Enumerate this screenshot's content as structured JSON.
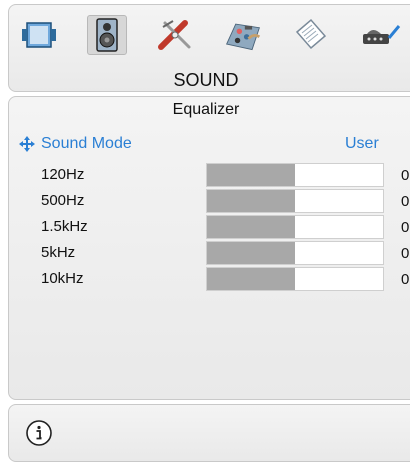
{
  "menu": {
    "icons": [
      {
        "name": "picture-icon",
        "selected": false
      },
      {
        "name": "speaker-icon",
        "selected": true
      },
      {
        "name": "tools-icon",
        "selected": false
      },
      {
        "name": "settings-icon",
        "selected": false
      },
      {
        "name": "book-icon",
        "selected": false
      },
      {
        "name": "source-icon",
        "selected": false
      }
    ],
    "title": "SOUND"
  },
  "main": {
    "subtitle": "Equalizer",
    "mode": {
      "label": "Sound Mode",
      "value": "User"
    },
    "bands": [
      {
        "label": "120Hz",
        "value": "0",
        "level": 0.5
      },
      {
        "label": "500Hz",
        "value": "0",
        "level": 0.5
      },
      {
        "label": "1.5kHz",
        "value": "0",
        "level": 0.5
      },
      {
        "label": "5kHz",
        "value": "0",
        "level": 0.5
      },
      {
        "label": "10kHz",
        "value": "0",
        "level": 0.5
      }
    ]
  },
  "footer": {
    "icon": "info-icon"
  },
  "colors": {
    "accent": "#2a7fd4",
    "bar_fill": "#a8a8a8"
  }
}
